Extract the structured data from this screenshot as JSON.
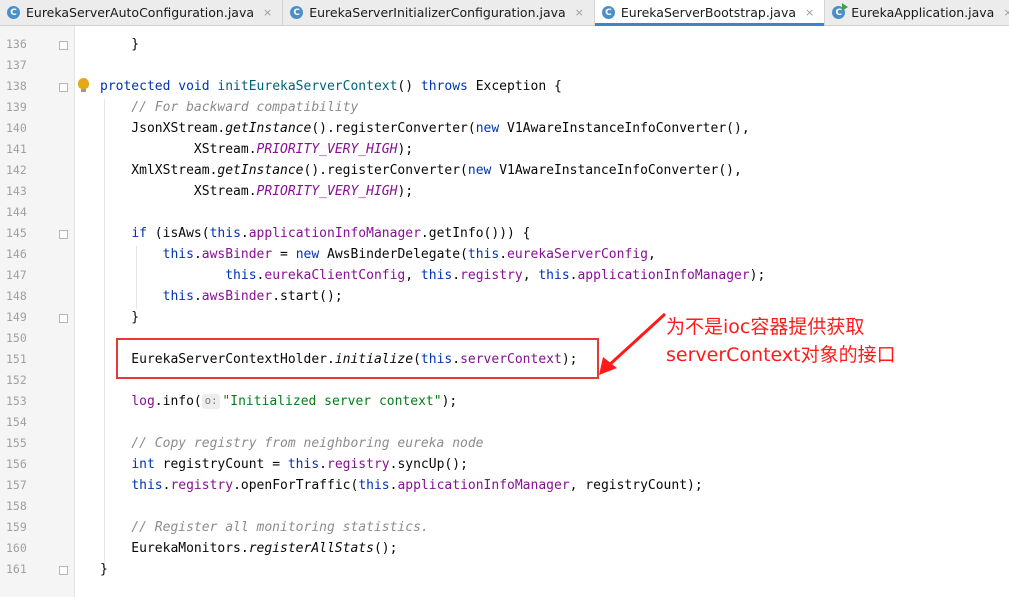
{
  "tabs": [
    {
      "label": "EurekaServerAutoConfiguration.java",
      "active": false,
      "icon": "java-class-icon",
      "closable": true
    },
    {
      "label": "EurekaServerInitializerConfiguration.java",
      "active": false,
      "icon": "java-class-icon",
      "closable": true
    },
    {
      "label": "EurekaServerBootstrap.java",
      "active": true,
      "icon": "java-class-icon",
      "closable": true
    },
    {
      "label": "EurekaApplication.java",
      "active": false,
      "icon": "java-run-class-icon",
      "closable": true
    }
  ],
  "icons": {
    "class": "C",
    "close": "×"
  },
  "lines": [
    {
      "n": "136",
      "t": [
        {
          "c": "    }",
          "s": ""
        }
      ]
    },
    {
      "n": "137",
      "t": []
    },
    {
      "n": "138",
      "t": [
        {
          "c": "protected void ",
          "s": "kw"
        },
        {
          "c": "initEurekaServerContext",
          "s": "fn"
        },
        {
          "c": "() ",
          "s": ""
        },
        {
          "c": "throws ",
          "s": "kw"
        },
        {
          "c": "Exception {",
          "s": ""
        }
      ]
    },
    {
      "n": "139",
      "t": [
        {
          "c": "    // For backward compatibility",
          "s": "cm"
        }
      ]
    },
    {
      "n": "140",
      "t": [
        {
          "c": "    JsonXStream.",
          "s": ""
        },
        {
          "c": "getInstance",
          "s": "st"
        },
        {
          "c": "().registerConverter(",
          "s": ""
        },
        {
          "c": "new ",
          "s": "kw"
        },
        {
          "c": "V1AwareInstanceInfoConverter(),",
          "s": ""
        }
      ]
    },
    {
      "n": "141",
      "t": [
        {
          "c": "            XStream.",
          "s": ""
        },
        {
          "c": "PRIORITY_VERY_HIGH",
          "s": "cst"
        },
        {
          "c": ");",
          "s": ""
        }
      ]
    },
    {
      "n": "142",
      "t": [
        {
          "c": "    XmlXStream.",
          "s": ""
        },
        {
          "c": "getInstance",
          "s": "st"
        },
        {
          "c": "().registerConverter(",
          "s": ""
        },
        {
          "c": "new ",
          "s": "kw"
        },
        {
          "c": "V1AwareInstanceInfoConverter(),",
          "s": ""
        }
      ]
    },
    {
      "n": "143",
      "t": [
        {
          "c": "            XStream.",
          "s": ""
        },
        {
          "c": "PRIORITY_VERY_HIGH",
          "s": "cst"
        },
        {
          "c": ");",
          "s": ""
        }
      ]
    },
    {
      "n": "144",
      "t": []
    },
    {
      "n": "145",
      "t": [
        {
          "c": "    ",
          "s": ""
        },
        {
          "c": "if ",
          "s": "kw"
        },
        {
          "c": "(isAws(",
          "s": ""
        },
        {
          "c": "this",
          "s": "kw"
        },
        {
          "c": ".",
          "s": ""
        },
        {
          "c": "applicationInfoManager",
          "s": "fld"
        },
        {
          "c": ".getInfo())) {",
          "s": ""
        }
      ]
    },
    {
      "n": "146",
      "t": [
        {
          "c": "        ",
          "s": ""
        },
        {
          "c": "this",
          "s": "kw"
        },
        {
          "c": ".",
          "s": ""
        },
        {
          "c": "awsBinder",
          "s": "fld"
        },
        {
          "c": " = ",
          "s": ""
        },
        {
          "c": "new ",
          "s": "kw"
        },
        {
          "c": "AwsBinderDelegate(",
          "s": ""
        },
        {
          "c": "this",
          "s": "kw"
        },
        {
          "c": ".",
          "s": ""
        },
        {
          "c": "eurekaServerConfig",
          "s": "fld"
        },
        {
          "c": ",",
          "s": ""
        }
      ]
    },
    {
      "n": "147",
      "t": [
        {
          "c": "                ",
          "s": ""
        },
        {
          "c": "this",
          "s": "kw"
        },
        {
          "c": ".",
          "s": ""
        },
        {
          "c": "eurekaClientConfig",
          "s": "fld"
        },
        {
          "c": ", ",
          "s": ""
        },
        {
          "c": "this",
          "s": "kw"
        },
        {
          "c": ".",
          "s": ""
        },
        {
          "c": "registry",
          "s": "fld"
        },
        {
          "c": ", ",
          "s": ""
        },
        {
          "c": "this",
          "s": "kw"
        },
        {
          "c": ".",
          "s": ""
        },
        {
          "c": "applicationInfoManager",
          "s": "fld"
        },
        {
          "c": ");",
          "s": ""
        }
      ]
    },
    {
      "n": "148",
      "t": [
        {
          "c": "        ",
          "s": ""
        },
        {
          "c": "this",
          "s": "kw"
        },
        {
          "c": ".",
          "s": ""
        },
        {
          "c": "awsBinder",
          "s": "fld"
        },
        {
          "c": ".start();",
          "s": ""
        }
      ]
    },
    {
      "n": "149",
      "t": [
        {
          "c": "    }",
          "s": ""
        }
      ]
    },
    {
      "n": "150",
      "t": []
    },
    {
      "n": "151",
      "t": [
        {
          "c": "    EurekaServerContextHolder.",
          "s": ""
        },
        {
          "c": "initialize",
          "s": "st"
        },
        {
          "c": "(",
          "s": ""
        },
        {
          "c": "this",
          "s": "kw"
        },
        {
          "c": ".",
          "s": ""
        },
        {
          "c": "serverContext",
          "s": "fld"
        },
        {
          "c": ");",
          "s": ""
        }
      ]
    },
    {
      "n": "152",
      "t": []
    },
    {
      "n": "153",
      "t": [
        {
          "c": "    ",
          "s": ""
        },
        {
          "c": "log",
          "s": "fld"
        },
        {
          "c": ".info(",
          "s": ""
        },
        {
          "c": "o:",
          "s": "hint"
        },
        {
          "c": "\"Initialized server context\"",
          "s": "str"
        },
        {
          "c": ");",
          "s": ""
        }
      ]
    },
    {
      "n": "154",
      "t": []
    },
    {
      "n": "155",
      "t": [
        {
          "c": "    // Copy registry from neighboring eureka node",
          "s": "cm"
        }
      ]
    },
    {
      "n": "156",
      "t": [
        {
          "c": "    ",
          "s": ""
        },
        {
          "c": "int ",
          "s": "kw"
        },
        {
          "c": "registryCount = ",
          "s": ""
        },
        {
          "c": "this",
          "s": "kw"
        },
        {
          "c": ".",
          "s": ""
        },
        {
          "c": "registry",
          "s": "fld"
        },
        {
          "c": ".syncUp();",
          "s": ""
        }
      ]
    },
    {
      "n": "157",
      "t": [
        {
          "c": "    ",
          "s": ""
        },
        {
          "c": "this",
          "s": "kw"
        },
        {
          "c": ".",
          "s": ""
        },
        {
          "c": "registry",
          "s": "fld"
        },
        {
          "c": ".openForTraffic(",
          "s": ""
        },
        {
          "c": "this",
          "s": "kw"
        },
        {
          "c": ".",
          "s": ""
        },
        {
          "c": "applicationInfoManager",
          "s": "fld"
        },
        {
          "c": ", registryCount);",
          "s": ""
        }
      ]
    },
    {
      "n": "158",
      "t": []
    },
    {
      "n": "159",
      "t": [
        {
          "c": "    // Register all monitoring statistics.",
          "s": "cm"
        }
      ]
    },
    {
      "n": "160",
      "t": [
        {
          "c": "    EurekaMonitors.",
          "s": ""
        },
        {
          "c": "registerAllStats",
          "s": "st"
        },
        {
          "c": "();",
          "s": ""
        }
      ]
    },
    {
      "n": "161",
      "t": [
        {
          "c": "}",
          "s": ""
        }
      ]
    }
  ],
  "annotation": {
    "line1": "为不是ioc容器提供获取",
    "line2": "serverContext对象的接口",
    "color": "#ff1a1a"
  },
  "colors": {
    "keyword": "#0033b3",
    "field": "#871094",
    "comment": "#8c8c8c",
    "string": "#067d17",
    "method": "#00627a",
    "tab_accent": "#4083c9"
  }
}
